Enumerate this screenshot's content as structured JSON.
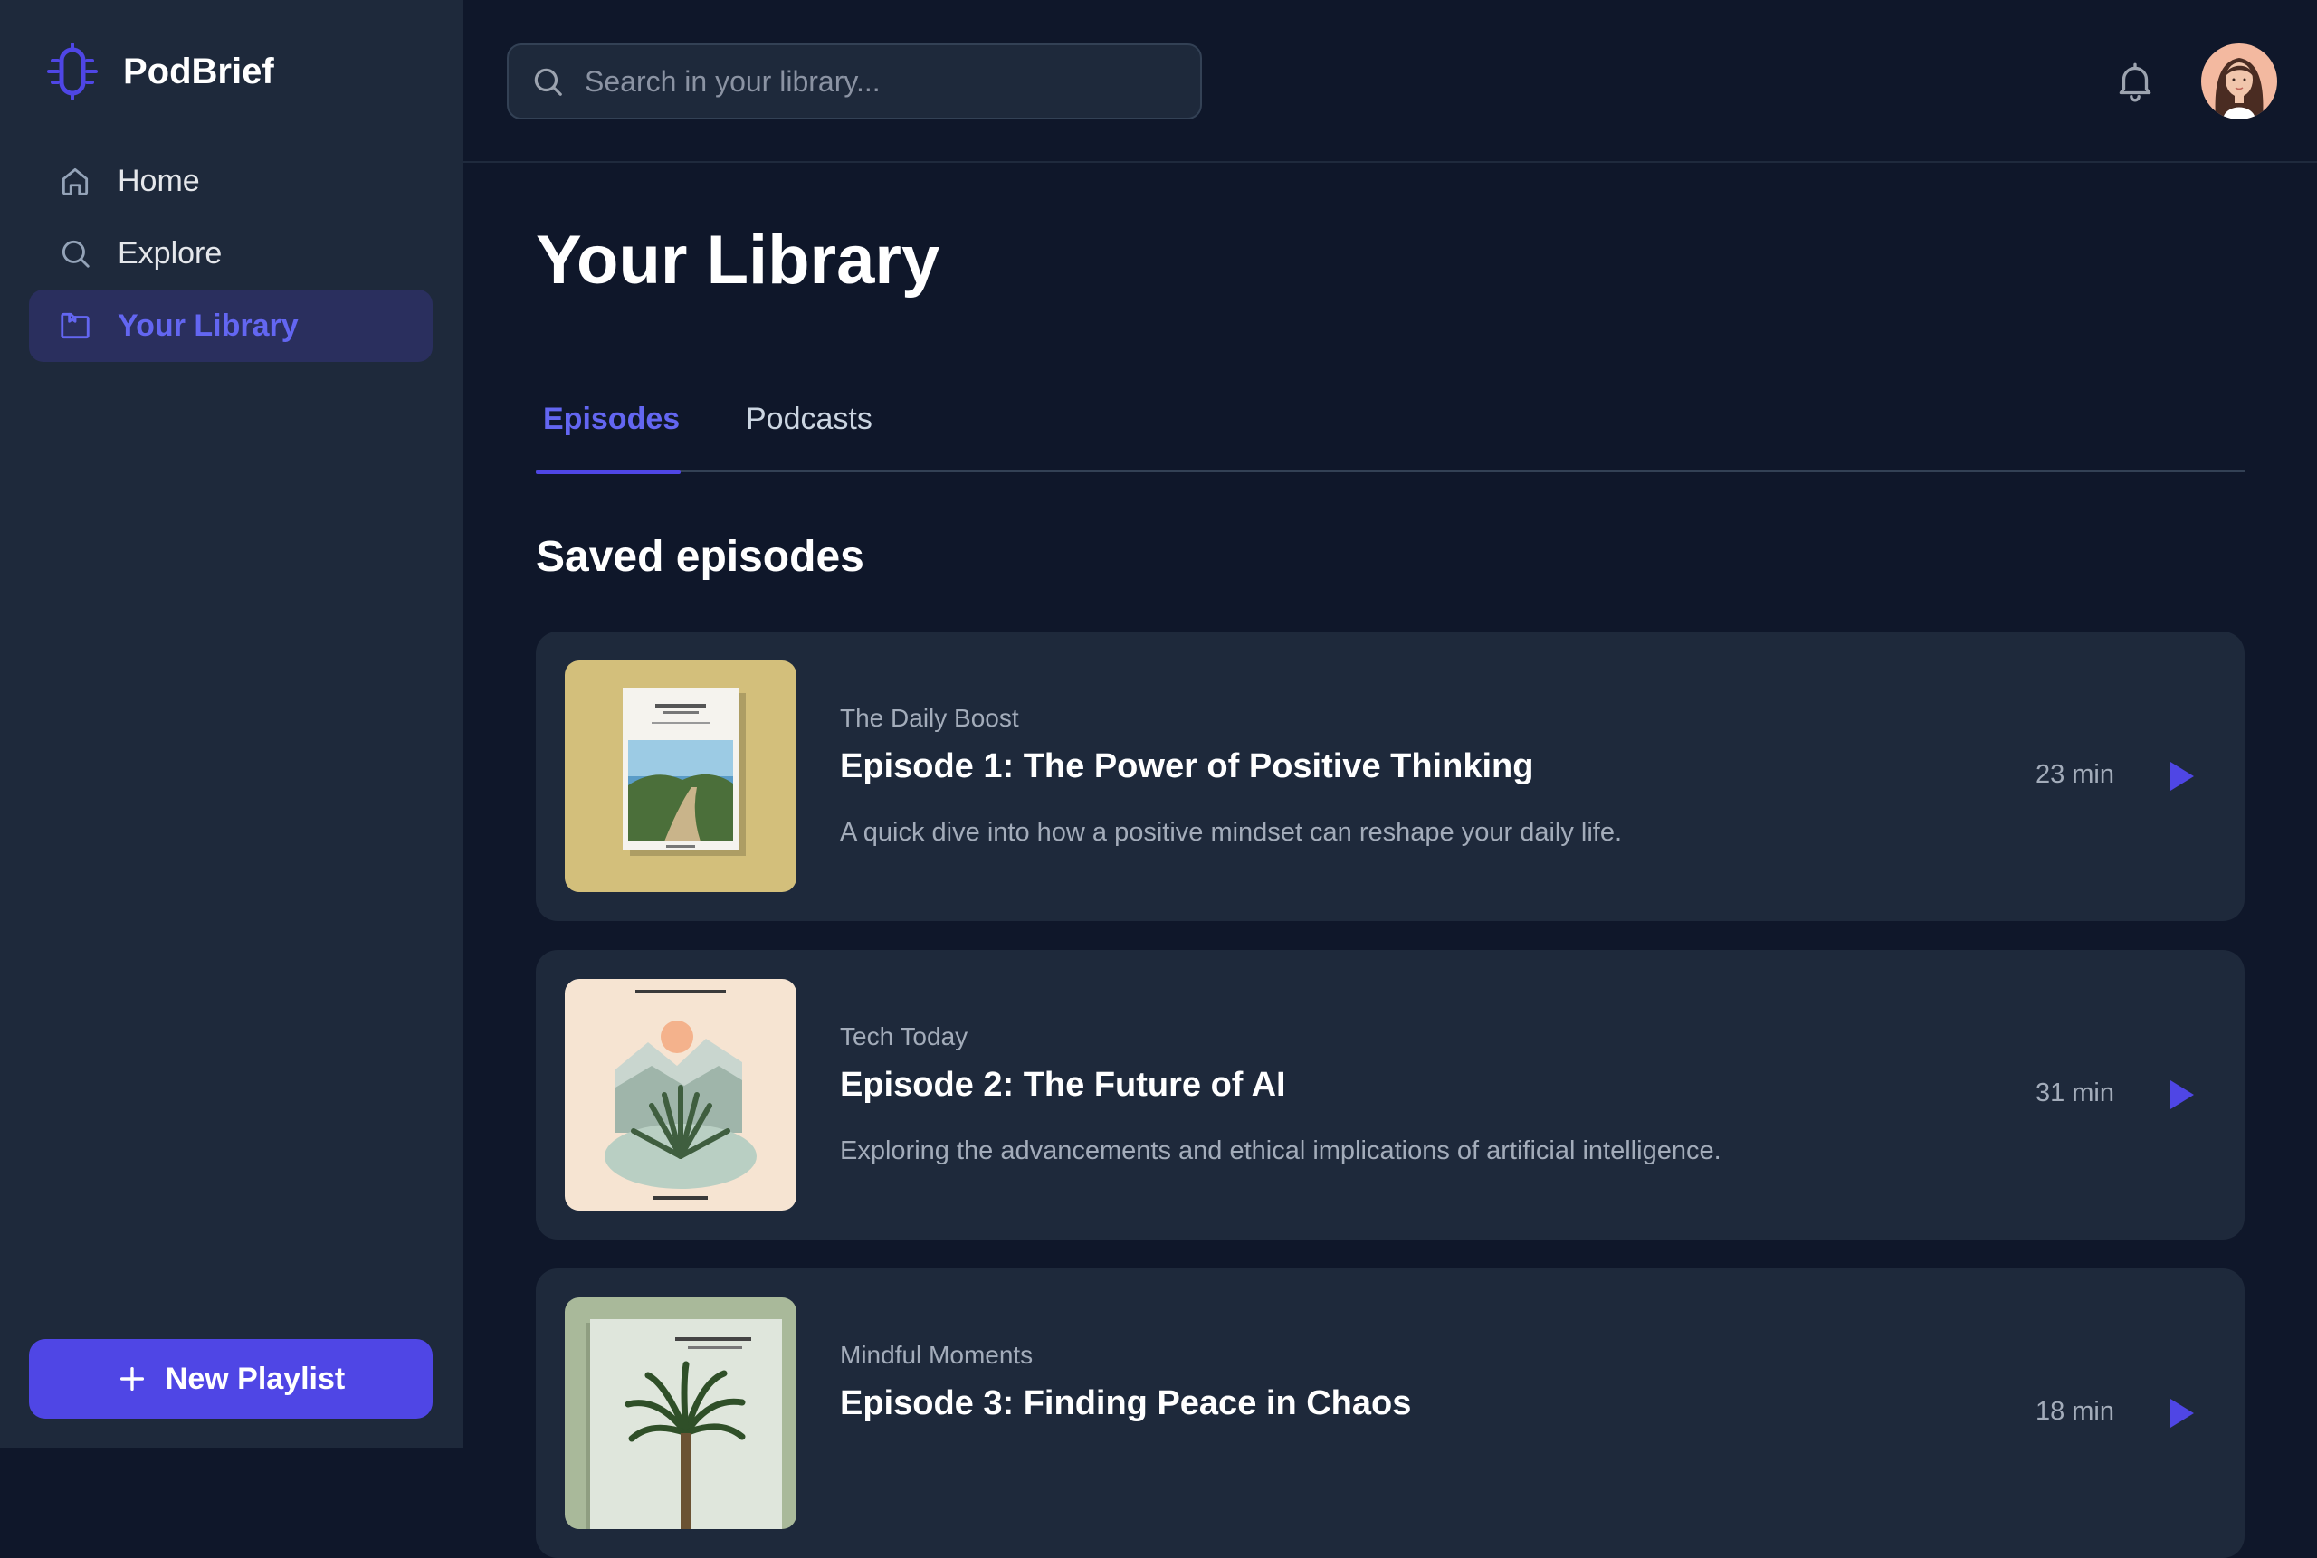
{
  "app": {
    "name": "PodBrief"
  },
  "sidebar": {
    "items": [
      {
        "label": "Home",
        "icon": "home-icon"
      },
      {
        "label": "Explore",
        "icon": "search-icon"
      },
      {
        "label": "Your Library",
        "icon": "library-icon",
        "active": true
      }
    ],
    "new_playlist_label": "New Playlist"
  },
  "header": {
    "search_placeholder": "Search in your library...",
    "notifications_icon": "bell-icon"
  },
  "main": {
    "title": "Your Library",
    "tabs": [
      {
        "label": "Episodes",
        "active": true
      },
      {
        "label": "Podcasts"
      }
    ],
    "section_title": "Saved episodes",
    "episodes": [
      {
        "show": "The Daily Boost",
        "title": "Episode 1: The Power of Positive Thinking",
        "description": "A quick dive into how a positive mindset can reshape your daily life.",
        "duration": "23 min"
      },
      {
        "show": "Tech Today",
        "title": "Episode 2: The Future of AI",
        "description": "Exploring the advancements and ethical implications of artificial intelligence.",
        "duration": "31 min"
      },
      {
        "show": "Mindful Moments",
        "title": "Episode 3: Finding Peace in Chaos",
        "description": "",
        "duration": "18 min"
      }
    ]
  },
  "colors": {
    "background": "#0f172a",
    "sidebar": "#1e293b",
    "accent": "#4f46e5",
    "accent_text": "#6366f1",
    "card": "#1e293b"
  }
}
